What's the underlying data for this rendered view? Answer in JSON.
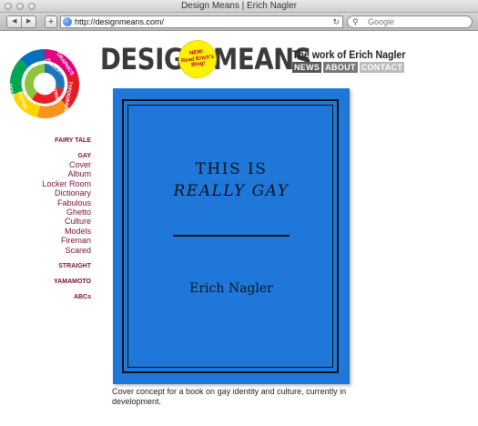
{
  "window": {
    "title": "Design Means | Erich Nagler"
  },
  "toolbar": {
    "back_icon": "back-icon",
    "forward_icon": "forward-icon",
    "add_label": "+",
    "url": "http://designmeans.com/",
    "search_placeholder": "Google"
  },
  "header": {
    "brand": "DESIGN MEANS",
    "badge_line1": "NEW:",
    "badge_line2": "Read Erich's",
    "badge_line3": "Blog!",
    "tagline": "The work of Erich Nagler",
    "nav": [
      "NEWS",
      "ABOUT",
      "CONTACT"
    ]
  },
  "logo_words": [
    "MAGAZINES",
    "OBJECTS",
    "BOOKS",
    "GRAPHICS",
    "WRITING",
    "TYPOGRAPHY",
    "SPACES",
    "ILLUSTRATION"
  ],
  "sidebar": {
    "fairy_tale": "FAIRY TALE",
    "gay": "GAY",
    "gay_items": [
      "Cover",
      "Album",
      "Locker Room",
      "Dictionary",
      "Fabulous",
      "Ghetto",
      "Culture",
      "Models",
      "Fireman",
      "Scared"
    ],
    "straight": "STRAIGHT",
    "yamamoto": "YAMAMOTO",
    "abcs": "ABCs"
  },
  "book": {
    "title_line1": "THIS IS",
    "title_line2": "REALLY GAY",
    "author": "Erich Nagler",
    "cover_color": "#1f77d9"
  },
  "caption": "Cover concept for a book on gay identity and culture, currently in development.",
  "colors": {
    "nav_link": "#7a1033",
    "badge": "#fff200"
  }
}
